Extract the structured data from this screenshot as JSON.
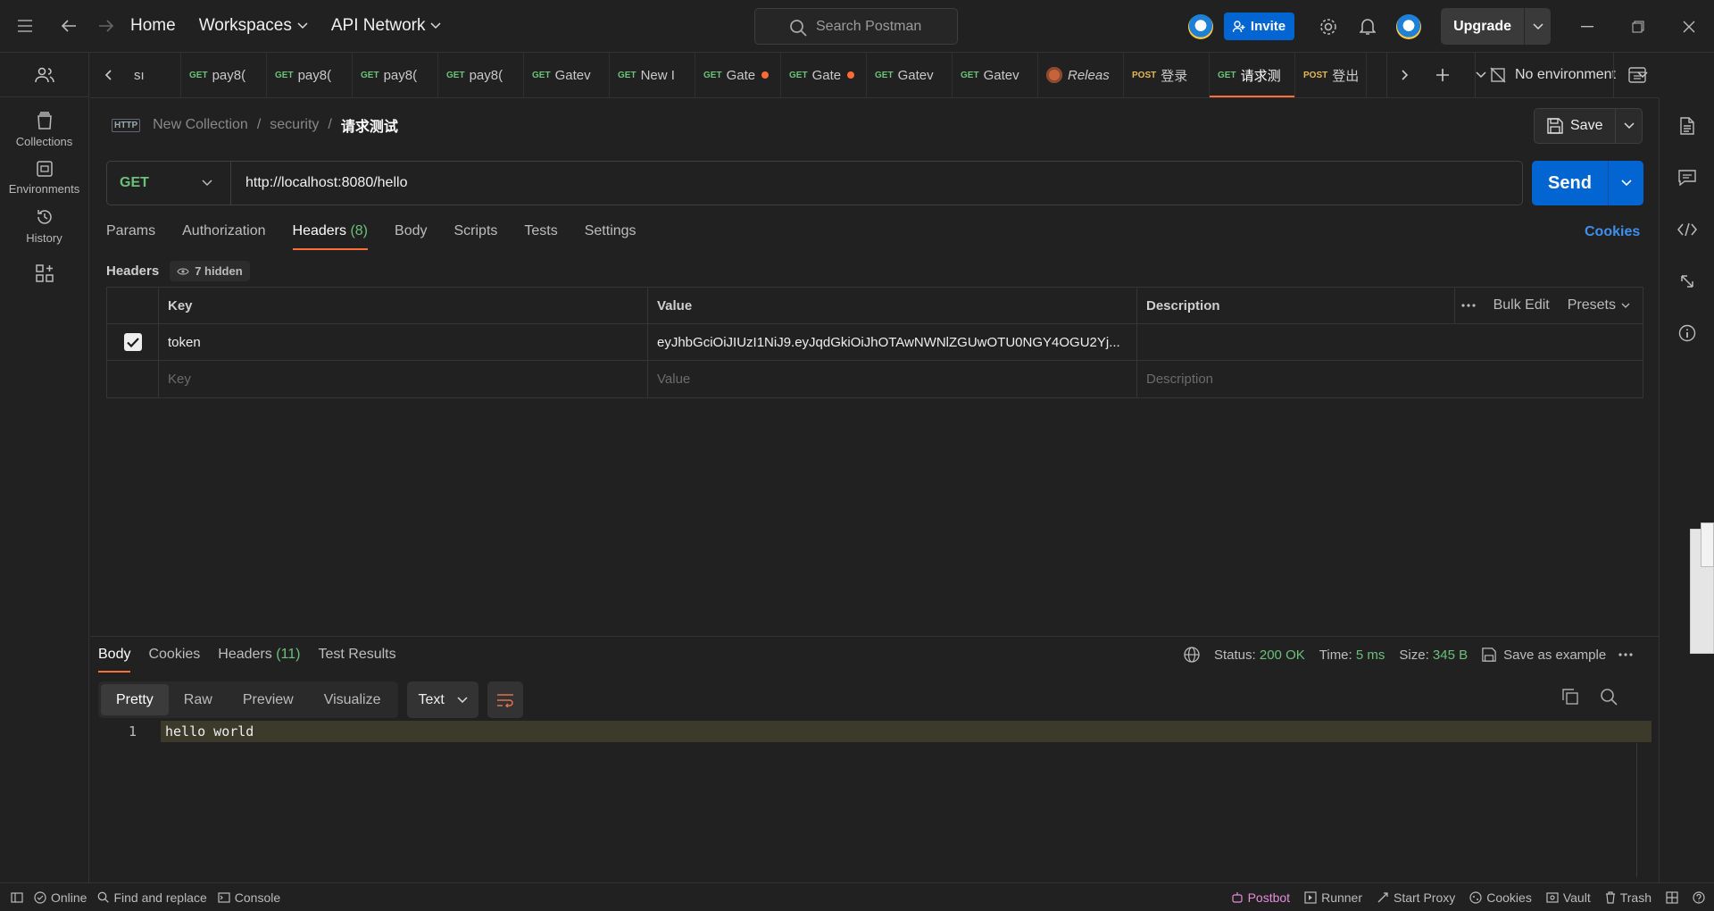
{
  "topbar": {
    "home": "Home",
    "workspaces": "Workspaces",
    "api_network": "API Network",
    "search_placeholder": "Search Postman",
    "invite": "Invite",
    "upgrade": "Upgrade"
  },
  "sidebar": {
    "items": [
      {
        "label": "Collections",
        "icon": "collections-icon"
      },
      {
        "label": "Environments",
        "icon": "environments-icon"
      },
      {
        "label": "History",
        "icon": "history-icon"
      }
    ]
  },
  "tabs": [
    {
      "method": "",
      "label": "sı",
      "dot": false
    },
    {
      "method": "GET",
      "label": "pay8(",
      "dot": false
    },
    {
      "method": "GET",
      "label": "pay8(",
      "dot": false
    },
    {
      "method": "GET",
      "label": "pay8(",
      "dot": false
    },
    {
      "method": "GET",
      "label": "pay8(",
      "dot": false
    },
    {
      "method": "GET",
      "label": "Gatev",
      "dot": false
    },
    {
      "method": "GET",
      "label": "New I",
      "dot": false
    },
    {
      "method": "GET",
      "label": "Gate",
      "dot": true
    },
    {
      "method": "GET",
      "label": "Gate",
      "dot": true
    },
    {
      "method": "GET",
      "label": "Gatev",
      "dot": false
    },
    {
      "method": "GET",
      "label": "Gatev",
      "dot": false
    },
    {
      "method": "",
      "label": "Releas",
      "dot": false,
      "release": true
    },
    {
      "method": "POST",
      "label": "登录",
      "dot": false
    },
    {
      "method": "GET",
      "label": "请求测",
      "dot": true,
      "active": true
    },
    {
      "method": "POST",
      "label": "登出",
      "dot": false
    }
  ],
  "environment": "No environment",
  "breadcrumb": {
    "badge": "HTTP",
    "collection": "New Collection",
    "folder": "security",
    "request": "请求测试",
    "sep": "/"
  },
  "save_label": "Save",
  "request": {
    "method": "GET",
    "url": "http://localhost:8080/hello",
    "send": "Send"
  },
  "request_tabs": {
    "params": "Params",
    "authorization": "Authorization",
    "headers": "Headers",
    "headers_count": "(8)",
    "body": "Body",
    "scripts": "Scripts",
    "tests": "Tests",
    "settings": "Settings",
    "cookies": "Cookies"
  },
  "headers_section": {
    "title": "Headers",
    "hidden": "7 hidden"
  },
  "headers_table": {
    "columns": {
      "key": "Key",
      "value": "Value",
      "description": "Description"
    },
    "bulk_edit": "Bulk Edit",
    "presets": "Presets",
    "rows": [
      {
        "checked": true,
        "key": "token",
        "value": "eyJhbGciOiJIUzI1NiJ9.eyJqdGkiOiJhOTAwNWNlZGUwOTU0NGY4OGU2Yj...",
        "description": ""
      }
    ],
    "placeholder": {
      "key": "Key",
      "value": "Value",
      "description": "Description"
    }
  },
  "response": {
    "tabs": {
      "body": "Body",
      "cookies": "Cookies",
      "headers": "Headers",
      "headers_count": "(11)",
      "test_results": "Test Results"
    },
    "status_label": "Status:",
    "status_value": "200 OK",
    "time_label": "Time:",
    "time_value": "5 ms",
    "size_label": "Size:",
    "size_value": "345 B",
    "save_example": "Save as example",
    "views": {
      "pretty": "Pretty",
      "raw": "Raw",
      "preview": "Preview",
      "visualize": "Visualize"
    },
    "format": "Text",
    "line_number": "1",
    "body_text": "hello world"
  },
  "statusbar": {
    "online": "Online",
    "find_replace": "Find and replace",
    "console": "Console",
    "postbot": "Postbot",
    "runner": "Runner",
    "start_proxy": "Start Proxy",
    "cookies": "Cookies",
    "vault": "Vault",
    "trash": "Trash"
  },
  "colors": {
    "accent": "#ff6c37",
    "primary": "#0265d2",
    "get": "#6cc07a",
    "post": "#e6b85c"
  }
}
